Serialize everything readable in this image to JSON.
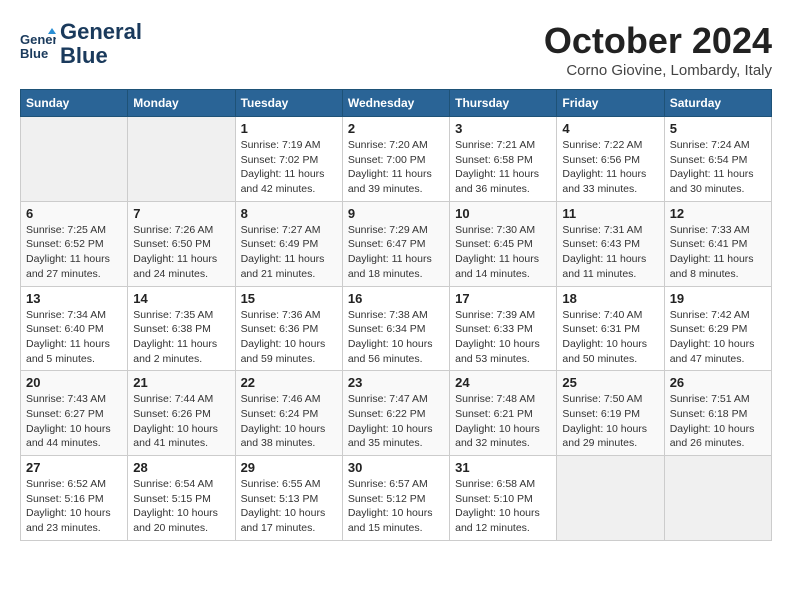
{
  "header": {
    "logo_line1": "General",
    "logo_line2": "Blue",
    "month_title": "October 2024",
    "location": "Corno Giovine, Lombardy, Italy"
  },
  "days_of_week": [
    "Sunday",
    "Monday",
    "Tuesday",
    "Wednesday",
    "Thursday",
    "Friday",
    "Saturday"
  ],
  "weeks": [
    [
      {
        "day": "",
        "info": ""
      },
      {
        "day": "",
        "info": ""
      },
      {
        "day": "1",
        "info": "Sunrise: 7:19 AM\nSunset: 7:02 PM\nDaylight: 11 hours and 42 minutes."
      },
      {
        "day": "2",
        "info": "Sunrise: 7:20 AM\nSunset: 7:00 PM\nDaylight: 11 hours and 39 minutes."
      },
      {
        "day": "3",
        "info": "Sunrise: 7:21 AM\nSunset: 6:58 PM\nDaylight: 11 hours and 36 minutes."
      },
      {
        "day": "4",
        "info": "Sunrise: 7:22 AM\nSunset: 6:56 PM\nDaylight: 11 hours and 33 minutes."
      },
      {
        "day": "5",
        "info": "Sunrise: 7:24 AM\nSunset: 6:54 PM\nDaylight: 11 hours and 30 minutes."
      }
    ],
    [
      {
        "day": "6",
        "info": "Sunrise: 7:25 AM\nSunset: 6:52 PM\nDaylight: 11 hours and 27 minutes."
      },
      {
        "day": "7",
        "info": "Sunrise: 7:26 AM\nSunset: 6:50 PM\nDaylight: 11 hours and 24 minutes."
      },
      {
        "day": "8",
        "info": "Sunrise: 7:27 AM\nSunset: 6:49 PM\nDaylight: 11 hours and 21 minutes."
      },
      {
        "day": "9",
        "info": "Sunrise: 7:29 AM\nSunset: 6:47 PM\nDaylight: 11 hours and 18 minutes."
      },
      {
        "day": "10",
        "info": "Sunrise: 7:30 AM\nSunset: 6:45 PM\nDaylight: 11 hours and 14 minutes."
      },
      {
        "day": "11",
        "info": "Sunrise: 7:31 AM\nSunset: 6:43 PM\nDaylight: 11 hours and 11 minutes."
      },
      {
        "day": "12",
        "info": "Sunrise: 7:33 AM\nSunset: 6:41 PM\nDaylight: 11 hours and 8 minutes."
      }
    ],
    [
      {
        "day": "13",
        "info": "Sunrise: 7:34 AM\nSunset: 6:40 PM\nDaylight: 11 hours and 5 minutes."
      },
      {
        "day": "14",
        "info": "Sunrise: 7:35 AM\nSunset: 6:38 PM\nDaylight: 11 hours and 2 minutes."
      },
      {
        "day": "15",
        "info": "Sunrise: 7:36 AM\nSunset: 6:36 PM\nDaylight: 10 hours and 59 minutes."
      },
      {
        "day": "16",
        "info": "Sunrise: 7:38 AM\nSunset: 6:34 PM\nDaylight: 10 hours and 56 minutes."
      },
      {
        "day": "17",
        "info": "Sunrise: 7:39 AM\nSunset: 6:33 PM\nDaylight: 10 hours and 53 minutes."
      },
      {
        "day": "18",
        "info": "Sunrise: 7:40 AM\nSunset: 6:31 PM\nDaylight: 10 hours and 50 minutes."
      },
      {
        "day": "19",
        "info": "Sunrise: 7:42 AM\nSunset: 6:29 PM\nDaylight: 10 hours and 47 minutes."
      }
    ],
    [
      {
        "day": "20",
        "info": "Sunrise: 7:43 AM\nSunset: 6:27 PM\nDaylight: 10 hours and 44 minutes."
      },
      {
        "day": "21",
        "info": "Sunrise: 7:44 AM\nSunset: 6:26 PM\nDaylight: 10 hours and 41 minutes."
      },
      {
        "day": "22",
        "info": "Sunrise: 7:46 AM\nSunset: 6:24 PM\nDaylight: 10 hours and 38 minutes."
      },
      {
        "day": "23",
        "info": "Sunrise: 7:47 AM\nSunset: 6:22 PM\nDaylight: 10 hours and 35 minutes."
      },
      {
        "day": "24",
        "info": "Sunrise: 7:48 AM\nSunset: 6:21 PM\nDaylight: 10 hours and 32 minutes."
      },
      {
        "day": "25",
        "info": "Sunrise: 7:50 AM\nSunset: 6:19 PM\nDaylight: 10 hours and 29 minutes."
      },
      {
        "day": "26",
        "info": "Sunrise: 7:51 AM\nSunset: 6:18 PM\nDaylight: 10 hours and 26 minutes."
      }
    ],
    [
      {
        "day": "27",
        "info": "Sunrise: 6:52 AM\nSunset: 5:16 PM\nDaylight: 10 hours and 23 minutes."
      },
      {
        "day": "28",
        "info": "Sunrise: 6:54 AM\nSunset: 5:15 PM\nDaylight: 10 hours and 20 minutes."
      },
      {
        "day": "29",
        "info": "Sunrise: 6:55 AM\nSunset: 5:13 PM\nDaylight: 10 hours and 17 minutes."
      },
      {
        "day": "30",
        "info": "Sunrise: 6:57 AM\nSunset: 5:12 PM\nDaylight: 10 hours and 15 minutes."
      },
      {
        "day": "31",
        "info": "Sunrise: 6:58 AM\nSunset: 5:10 PM\nDaylight: 10 hours and 12 minutes."
      },
      {
        "day": "",
        "info": ""
      },
      {
        "day": "",
        "info": ""
      }
    ]
  ]
}
